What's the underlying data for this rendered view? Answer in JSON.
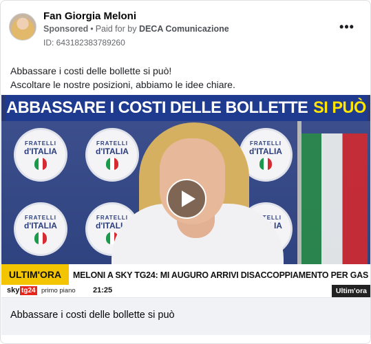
{
  "post": {
    "page_name": "Fan Giorgia Meloni",
    "sponsored_label": "Sponsored",
    "separator": "•",
    "paid_for_prefix": "Paid for by",
    "payer": "DECA Comunicazione",
    "id_label": "ID: 643182383789260",
    "more_icon": "•••",
    "text_line1": "Abbassare i costi delle bollette si può!",
    "text_line2": "Ascoltare le nostre posizioni, abbiamo le idee chiare."
  },
  "video": {
    "headline_white": "ABBASSARE I COSTI DELLE BOLLETTE",
    "headline_yellow": "SI PUÒ",
    "logo_top": "FRATELLI",
    "logo_bottom": "d'ITALIA",
    "ticker_label": "ULTIM'ORA",
    "ticker_text": "MELONI A SKY TG24: MI AUGURO ARRIVI DISACCOPPIAMENTO PER GAS",
    "channel_sky": "sky",
    "channel_tg": "tg24",
    "program": "primo piano",
    "time": "21:25",
    "badge": "Ultim'ora",
    "play_icon": "play-icon"
  },
  "footer": {
    "title": "Abbassare i costi delle bollette si può"
  },
  "colors": {
    "headline_bar": "#1f3b8f",
    "headline_yellow": "#ffe500",
    "ticker_label_bg": "#f2c500",
    "tg24_red": "#e4261c"
  }
}
